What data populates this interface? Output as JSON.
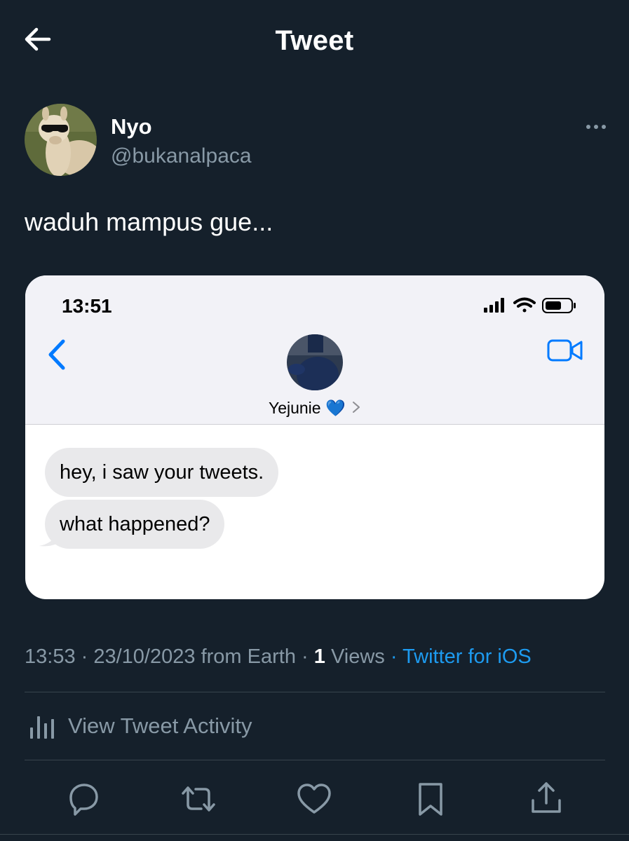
{
  "header": {
    "title": "Tweet",
    "back_icon": "arrow-left-icon"
  },
  "author": {
    "display_name": "Nyo",
    "handle": "@bukanalpaca",
    "more_icon": "more-horizontal-icon"
  },
  "tweet": {
    "text": "waduh mampus gue..."
  },
  "screenshot": {
    "status_time": "13:51",
    "contact_name": "Yejunie 💙",
    "messages": [
      "hey, i saw your tweets.",
      "what happened?"
    ],
    "icons": [
      "signal-icon",
      "wifi-icon",
      "battery-icon",
      "chevron-left-icon",
      "video-camera-icon",
      "chevron-right-icon"
    ]
  },
  "meta": {
    "time": "13:53",
    "date": "23/10/2023",
    "location": "from Earth",
    "views_count": "1",
    "views_label": "Views",
    "source": "Twitter for iOS"
  },
  "activity": {
    "label": "View Tweet Activity",
    "icon": "bar-chart-icon"
  },
  "actions": [
    "reply-icon",
    "retweet-icon",
    "like-icon",
    "bookmark-icon",
    "share-icon"
  ],
  "colors": {
    "background": "#15202b",
    "secondary_text": "#8899a6",
    "link": "#1d9bf0",
    "ios_blue": "#007aff"
  }
}
